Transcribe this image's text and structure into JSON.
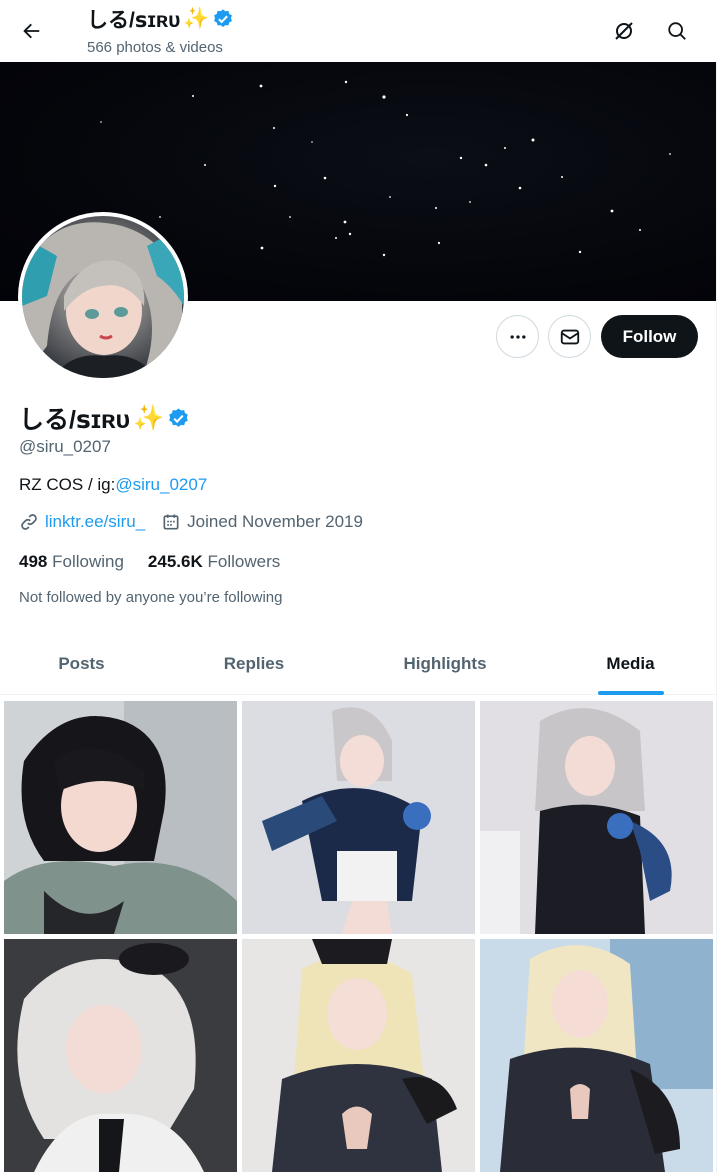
{
  "header": {
    "title": "しる/ꜱɪʀᴜ",
    "title_emoji": "✨",
    "subtitle": "566 photos & videos",
    "back_icon": "arrow-left-icon",
    "hide_icon": "circle-slash-icon",
    "search_icon": "search-icon"
  },
  "profile": {
    "display_name": "しる/ꜱɪʀᴜ",
    "name_emoji": "✨",
    "handle": "@siru_0207",
    "bio_prefix": "RZ COS / ig:",
    "bio_link": "@siru_0207",
    "website": "linktr.ee/siru_",
    "joined": "Joined November 2019",
    "following_count": "498",
    "following_label": "Following",
    "followers_count": "245.6K",
    "followers_label": "Followers",
    "not_followed_text": "Not followed by anyone you’re following"
  },
  "actions": {
    "more_icon": "more-dots-icon",
    "message_icon": "mail-icon",
    "follow_label": "Follow"
  },
  "tabs": [
    {
      "label": "Posts",
      "active": false
    },
    {
      "label": "Replies",
      "active": false
    },
    {
      "label": "Highlights",
      "active": false
    },
    {
      "label": "Media",
      "active": true
    }
  ],
  "colors": {
    "accent": "#1d9bf0",
    "text": "#0f1419",
    "secondary": "#536471",
    "follow_bg": "#0f1419"
  }
}
